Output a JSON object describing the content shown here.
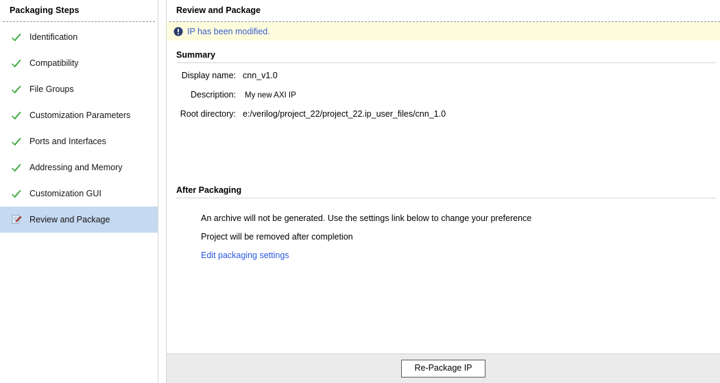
{
  "sidebar": {
    "title": "Packaging Steps",
    "steps": [
      {
        "label": "Identification",
        "icon": "check-icon",
        "state": "complete"
      },
      {
        "label": "Compatibility",
        "icon": "check-icon",
        "state": "complete"
      },
      {
        "label": "File Groups",
        "icon": "check-icon",
        "state": "complete"
      },
      {
        "label": "Customization Parameters",
        "icon": "check-icon",
        "state": "complete"
      },
      {
        "label": "Ports and Interfaces",
        "icon": "check-icon",
        "state": "complete"
      },
      {
        "label": "Addressing and Memory",
        "icon": "check-icon",
        "state": "complete"
      },
      {
        "label": "Customization GUI",
        "icon": "check-icon",
        "state": "complete"
      },
      {
        "label": "Review and Package",
        "icon": "edit-document-icon",
        "state": "selected"
      }
    ]
  },
  "panel": {
    "title": "Review and Package",
    "notice": {
      "icon": "info-icon",
      "text": "IP has been modified."
    },
    "summary": {
      "heading": "Summary",
      "rows": [
        {
          "label": "Display name:",
          "value": "cnn_v1.0"
        },
        {
          "label": "Description:",
          "value": "My new AXI IP"
        },
        {
          "label": "Root directory:",
          "value": "e:/verilog/project_22/project_22.ip_user_files/cnn_1.0"
        }
      ]
    },
    "after_packaging": {
      "heading": "After Packaging",
      "lines": [
        "An archive will not be generated. Use the settings link below to change your preference",
        "Project will be removed after completion"
      ],
      "link": "Edit packaging settings"
    }
  },
  "footer": {
    "repackage_label": "Re-Package IP"
  },
  "colors": {
    "check_green": "#3aa63a",
    "selected_row": "#c5d9f1",
    "notice_bg": "#fcfbdc",
    "notice_text": "#3c5fd0",
    "link": "#2a58e0",
    "footer_bg": "#ebebeb"
  }
}
